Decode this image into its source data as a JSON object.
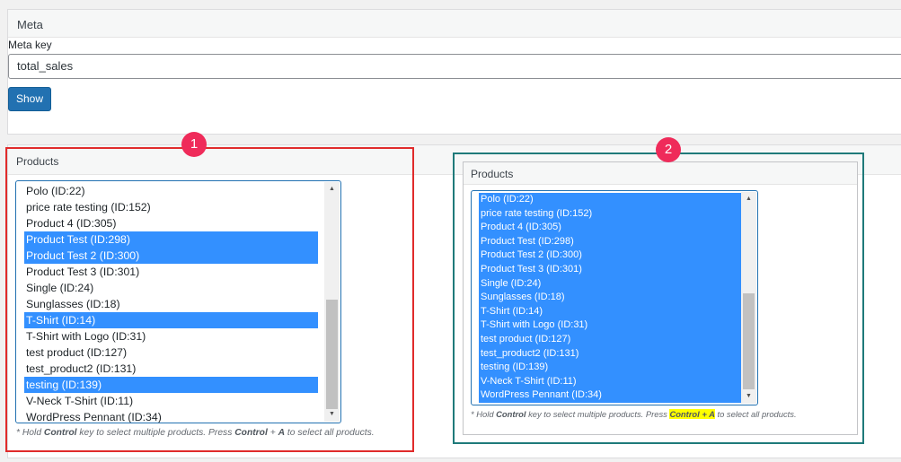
{
  "meta_panel": {
    "title": "Meta",
    "meta_key_label": "Meta key",
    "meta_key_value": "total_sales",
    "show_button": "Show"
  },
  "products_panel_1": {
    "title": "Products",
    "items": [
      {
        "label": "Polo (ID:22)",
        "selected": false
      },
      {
        "label": "price rate testing (ID:152)",
        "selected": false
      },
      {
        "label": "Product 4 (ID:305)",
        "selected": false
      },
      {
        "label": "Product Test (ID:298)",
        "selected": true
      },
      {
        "label": "Product Test 2 (ID:300)",
        "selected": true
      },
      {
        "label": "Product Test 3 (ID:301)",
        "selected": false
      },
      {
        "label": "Single (ID:24)",
        "selected": false
      },
      {
        "label": "Sunglasses (ID:18)",
        "selected": false
      },
      {
        "label": "T-Shirt (ID:14)",
        "selected": true
      },
      {
        "label": "T-Shirt with Logo (ID:31)",
        "selected": false
      },
      {
        "label": "test product (ID:127)",
        "selected": false
      },
      {
        "label": "test_product2 (ID:131)",
        "selected": false
      },
      {
        "label": "testing (ID:139)",
        "selected": true
      },
      {
        "label": "V-Neck T-Shirt (ID:11)",
        "selected": false
      },
      {
        "label": "WordPress Pennant (ID:34)",
        "selected": false
      }
    ],
    "note": {
      "pre": "* Hold ",
      "key1": "Control",
      "mid": " key to select multiple products. Press ",
      "key2": "Control",
      "plus": " + ",
      "key3": "A",
      "post": " to select all products."
    }
  },
  "products_panel_2": {
    "title": "Products",
    "items": [
      {
        "label": "Polo (ID:22)",
        "selected": true
      },
      {
        "label": "price rate testing (ID:152)",
        "selected": true
      },
      {
        "label": "Product 4 (ID:305)",
        "selected": true
      },
      {
        "label": "Product Test (ID:298)",
        "selected": true
      },
      {
        "label": "Product Test 2 (ID:300)",
        "selected": true
      },
      {
        "label": "Product Test 3 (ID:301)",
        "selected": true
      },
      {
        "label": "Single (ID:24)",
        "selected": true
      },
      {
        "label": "Sunglasses (ID:18)",
        "selected": true
      },
      {
        "label": "T-Shirt (ID:14)",
        "selected": true
      },
      {
        "label": "T-Shirt with Logo (ID:31)",
        "selected": true
      },
      {
        "label": "test product (ID:127)",
        "selected": true
      },
      {
        "label": "test_product2 (ID:131)",
        "selected": true
      },
      {
        "label": "testing (ID:139)",
        "selected": true
      },
      {
        "label": "V-Neck T-Shirt (ID:11)",
        "selected": true
      },
      {
        "label": "WordPress Pennant (ID:34)",
        "selected": true
      }
    ],
    "note": {
      "pre": "* Hold ",
      "key1": "Control",
      "mid": " key to select multiple products. Press ",
      "highlight": "Control + A",
      "post": " to select all products."
    }
  },
  "annotations": {
    "badge_1": "1",
    "badge_2": "2",
    "badge_color": "#ef2b5a",
    "box_1_color": "#e02b2b",
    "box_2_color": "#1f7a7a"
  },
  "colors": {
    "selection": "#3390ff",
    "button": "#2271b1",
    "highlight": "#ffff00"
  }
}
